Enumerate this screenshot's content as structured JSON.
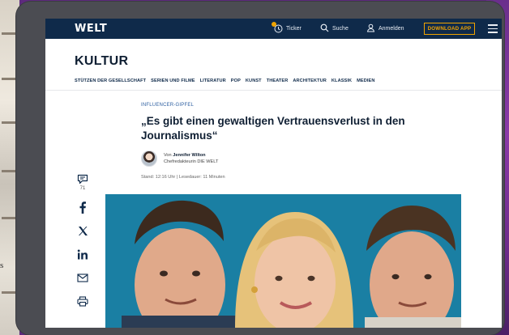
{
  "header": {
    "logo": "WELT",
    "ticker_label": "Ticker",
    "search_label": "Suche",
    "login_label": "Anmelden",
    "download_label": "DOWNLOAD APP"
  },
  "section": {
    "title": "KULTUR",
    "nav": [
      "STÜTZEN DER GESELLSCHAFT",
      "SERIEN UND FILME",
      "LITERATUR",
      "POP",
      "KUNST",
      "THEATER",
      "ARCHITEKTUR",
      "KLASSIK",
      "MEDIEN"
    ]
  },
  "article": {
    "kicker": "INFLUENCER-GIPFEL",
    "headline": "„Es gibt einen gewaltigen Vertrauensverlust in den Journalismus“",
    "author_prefix": "Von",
    "author_name": "Jennifer Wilton",
    "author_role": "Chefredakteurin DIE WELT",
    "meta": "Stand: 12:16 Uhr | Lesedauer: 11 Minuten"
  },
  "social": {
    "comment_count": "71"
  },
  "background": {
    "left_edge_glyph": "s"
  },
  "colors": {
    "nav_bg": "#0f2a4a",
    "accent": "#f0a300",
    "hero_bg": "#1a7fa3"
  }
}
